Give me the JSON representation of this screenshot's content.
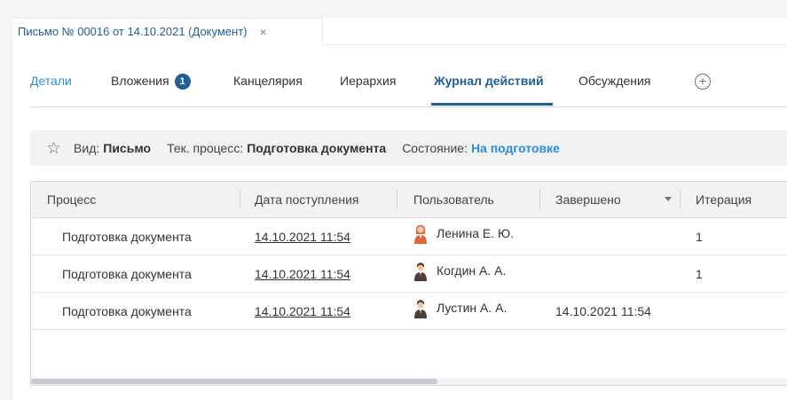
{
  "document_tab": {
    "title": "Письмо № 00016 от 14.10.2021 (Документ)",
    "close": "×"
  },
  "tabs": [
    {
      "label": "Детали"
    },
    {
      "label": "Вложения",
      "badge": "1"
    },
    {
      "label": "Канцелярия"
    },
    {
      "label": "Иерархия"
    },
    {
      "label": "Журнал действий"
    },
    {
      "label": "Обсуждения"
    }
  ],
  "add_tab_symbol": "+",
  "info": {
    "star": "☆",
    "kind_label": "Вид:",
    "kind_value": "Письмо",
    "process_label": "Тек. процесс:",
    "process_value": "Подготовка документа",
    "state_label": "Состояние:",
    "state_value": "На подготовке"
  },
  "table": {
    "columns": [
      "Процесс",
      "Дата поступления",
      "Пользователь",
      "Завершено",
      "Итерация"
    ],
    "rows": [
      {
        "process": "Подготовка документа",
        "date": "14.10.2021 11:54",
        "user": "Ленина Е. Ю.",
        "avatar": "female-user-icon",
        "done": "",
        "iteration": "1"
      },
      {
        "process": "Подготовка документа",
        "date": "14.10.2021 11:54",
        "user": "Когдин А. А.",
        "avatar": "male-user-icon",
        "done": "",
        "iteration": "1"
      },
      {
        "process": "Подготовка документа",
        "date": "14.10.2021 11:54",
        "user": "Лустин А. А.",
        "avatar": "male-user-icon",
        "done": "14.10.2021 11:54",
        "iteration": ""
      }
    ]
  },
  "colors": {
    "accent": "#1f5e96",
    "link_blue": "#2f8fd6",
    "panel_bg": "#f0f2f4",
    "female_avatar": "#e0663a",
    "male_avatar": "#4a3f36"
  }
}
